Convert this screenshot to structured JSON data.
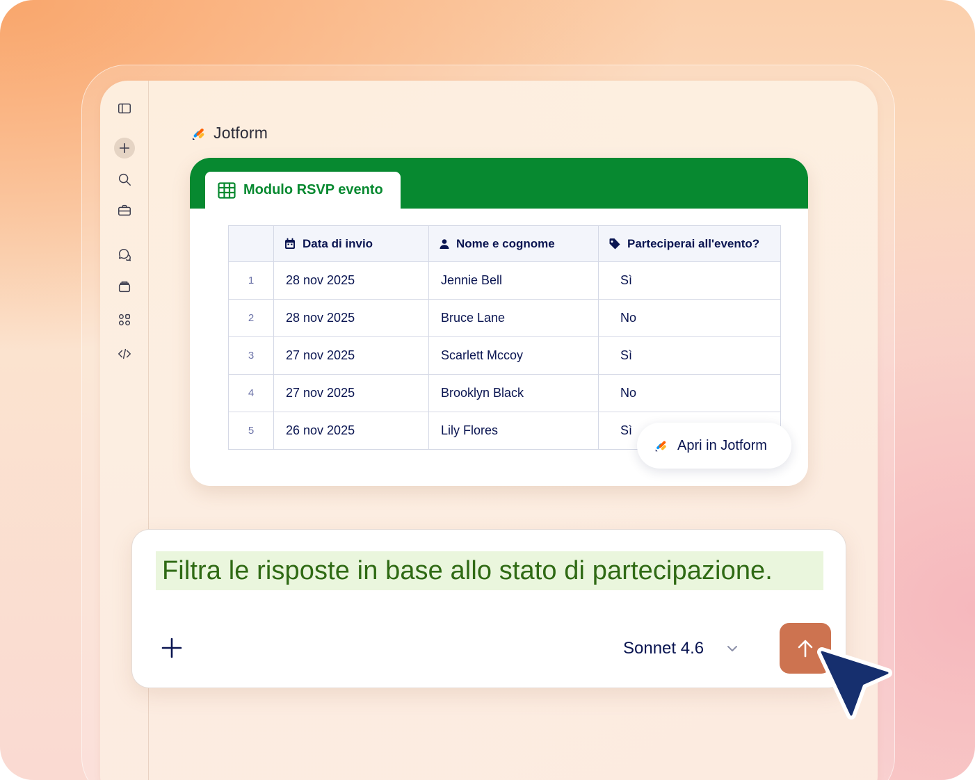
{
  "brand": {
    "name": "Jotform",
    "logo_icon": "jotform-logo-icon"
  },
  "sidebar": {
    "items": [
      {
        "name": "sidebar-toggle-icon"
      },
      {
        "name": "new-chat-icon"
      },
      {
        "name": "search-icon"
      },
      {
        "name": "briefcase-icon"
      },
      {
        "name": "chats-icon"
      },
      {
        "name": "artifacts-icon"
      },
      {
        "name": "apps-icon"
      },
      {
        "name": "code-icon"
      }
    ]
  },
  "form": {
    "tab_title": "Modulo RSVP evento",
    "tab_icon": "table-grid-icon",
    "header_color": "#078930",
    "columns": [
      {
        "label": "",
        "icon": ""
      },
      {
        "label": "Data di invio",
        "icon": "calendar-icon"
      },
      {
        "label": "Nome e cognome",
        "icon": "user-icon"
      },
      {
        "label": "Parteciperai all'evento?",
        "icon": "tag-icon"
      }
    ],
    "rows": [
      {
        "num": "1",
        "date": "28 nov 2025",
        "name": "Jennie Bell",
        "answer": "Sì"
      },
      {
        "num": "2",
        "date": "28 nov 2025",
        "name": "Bruce Lane",
        "answer": "No"
      },
      {
        "num": "3",
        "date": "27 nov 2025",
        "name": "Scarlett Mccoy",
        "answer": "Sì"
      },
      {
        "num": "4",
        "date": "27 nov 2025",
        "name": "Brooklyn Black",
        "answer": "No"
      },
      {
        "num": "5",
        "date": "26 nov 2025",
        "name": "Lily Flores",
        "answer": "Sì"
      }
    ],
    "open_button_label": "Apri in Jotform"
  },
  "prompt": {
    "text": "Filtra le risposte in base allo stato di partecipazione.",
    "model": "Sonnet 4.6",
    "send_color": "#cd7350"
  },
  "colors": {
    "accent_green": "#078930",
    "text_navy": "#0a1551",
    "send_orange": "#cd7350"
  }
}
